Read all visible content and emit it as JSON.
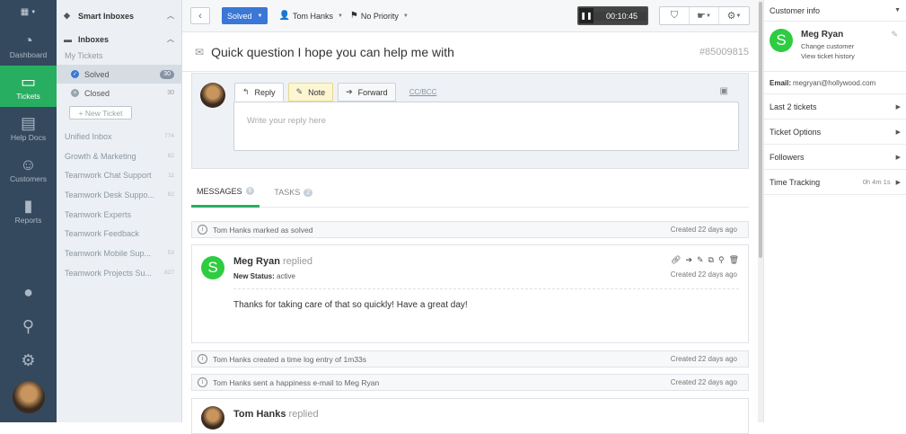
{
  "nav": {
    "items": [
      {
        "label": "Dashboard",
        "icon": "dashboard-icon"
      },
      {
        "label": "Tickets",
        "icon": "ticket-inbox-icon"
      },
      {
        "label": "Help Docs",
        "icon": "docs-icon"
      },
      {
        "label": "Customers",
        "icon": "customers-icon"
      },
      {
        "label": "Reports",
        "icon": "reports-icon"
      }
    ],
    "active_color": "#27ae60"
  },
  "sidebar": {
    "smart_inboxes": "Smart Inboxes",
    "inboxes": "Inboxes",
    "my_tickets": "My Tickets",
    "solved": {
      "label": "Solved",
      "count": "30"
    },
    "closed": {
      "label": "Closed",
      "count": "30"
    },
    "new_ticket": "+ New Ticket",
    "inbox_list": [
      {
        "label": "Unified Inbox",
        "count": "774"
      },
      {
        "label": "Growth & Marketing",
        "count": "82"
      },
      {
        "label": "Teamwork Chat Support",
        "count": "11"
      },
      {
        "label": "Teamwork Desk Suppo...",
        "count": "82"
      },
      {
        "label": "Teamwork Experts",
        "count": ""
      },
      {
        "label": "Teamwork Feedback",
        "count": ""
      },
      {
        "label": "Teamwork Mobile Sup...",
        "count": "53"
      },
      {
        "label": "Teamwork Projects Su...",
        "count": "827"
      }
    ]
  },
  "toolbar": {
    "status": "Solved",
    "status_color": "#3a77d6",
    "assignee": "Tom Hanks",
    "priority": "No Priority",
    "timer": "00:10:45"
  },
  "ticket": {
    "subject": "Quick question I hope you can help me with",
    "id": "#85009815"
  },
  "composer": {
    "reply": "Reply",
    "note": "Note",
    "forward": "Forward",
    "ccbcc": "CC/BCC",
    "placeholder": "Write your reply here"
  },
  "tabs": {
    "messages": "MESSAGES",
    "messages_count": "6",
    "tasks": "TASKS",
    "tasks_count": "2"
  },
  "events": [
    {
      "text": "Tom Hanks marked as solved",
      "date": "Created 22 days ago"
    },
    {
      "text": "Tom Hanks created a time log entry of 1m33s",
      "date": "Created 22 days ago"
    },
    {
      "text": "Tom Hanks sent a happiness e-mail to Meg Ryan",
      "date": "Created 22 days ago"
    }
  ],
  "message": {
    "avatar_letter": "S",
    "author": "Meg Ryan",
    "verb": "replied",
    "status_label": "New Status:",
    "status_value": "active",
    "date": "Created 22 days ago",
    "body": "Thanks for taking care of that so quickly! Have a great day!"
  },
  "message2": {
    "author": "Tom Hanks",
    "verb": "replied"
  },
  "right": {
    "customer_info": "Customer info",
    "avatar_letter": "S",
    "name": "Meg Ryan",
    "change_customer": "Change customer",
    "view_history": "View ticket history",
    "email_label": "Email:",
    "email": "megryan@hollywood.com",
    "last_tickets": "Last 2 tickets",
    "ticket_options": "Ticket Options",
    "followers": "Followers",
    "time_tracking": "Time Tracking",
    "time_value": "0h 4m 1s"
  }
}
